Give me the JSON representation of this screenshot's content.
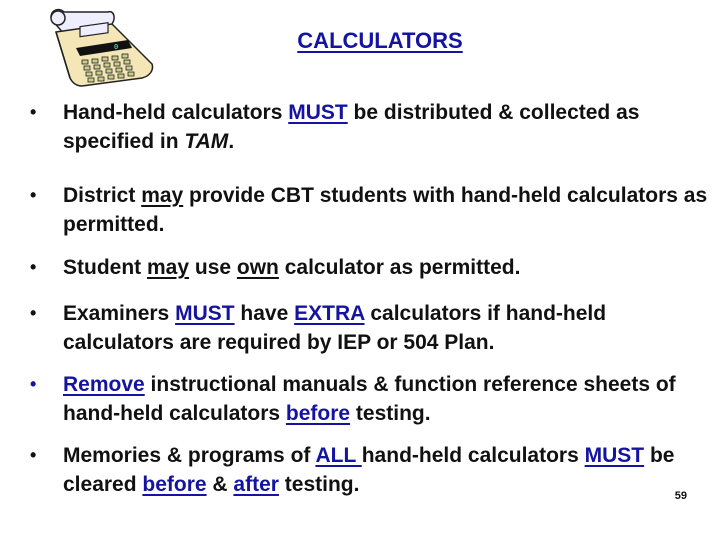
{
  "slide": {
    "title": "CALCULATORS",
    "page_number": "59",
    "icon": "calculator-icon",
    "colors": {
      "accent_blue": "#1414a0",
      "text": "#111111",
      "calculator_body": "#f5e6b8",
      "calculator_paper": "#eeeeff"
    },
    "bullets": [
      {
        "parts": [
          "Hand-held calculators ",
          "MUST",
          " be distributed & collected as specified in ",
          "TAM",
          "."
        ]
      },
      {
        "parts": [
          "District ",
          "may",
          " provide CBT students with hand-held calculators as permitted."
        ]
      },
      {
        "parts": [
          "Student ",
          "may",
          " use ",
          "own",
          " calculator as permitted."
        ]
      },
      {
        "parts": [
          "Examiners ",
          "MUST",
          " have ",
          "EXTRA",
          " calculators if hand-held calculators are required by IEP or 504 Plan."
        ]
      },
      {
        "parts": [
          "Remove",
          " instructional manuals & function reference sheets of hand-held calculators ",
          "before",
          " testing."
        ]
      },
      {
        "parts": [
          "Memories & programs of ",
          "ALL ",
          "hand-held calculators ",
          "MUST",
          " be cleared ",
          "before",
          " & ",
          "after",
          " testing."
        ]
      }
    ],
    "bullet_glyph": "•"
  }
}
